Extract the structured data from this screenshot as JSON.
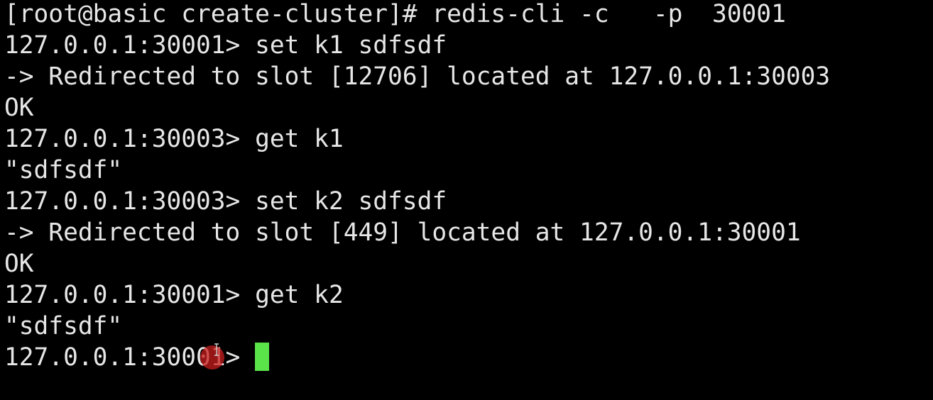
{
  "terminal": {
    "lines": [
      "[root@basic create-cluster]# redis-cli -c   -p  30001",
      "127.0.0.1:30001> set k1 sdfsdf",
      "-> Redirected to slot [12706] located at 127.0.0.1:30003",
      "OK",
      "127.0.0.1:30003> get k1",
      "\"sdfsdf\"",
      "127.0.0.1:30003> set k2 sdfsdf",
      "-> Redirected to slot [449] located at 127.0.0.1:30001",
      "OK",
      "127.0.0.1:30001> get k2",
      "\"sdfsdf\""
    ],
    "current_prompt": "127.0.0.1:30001> "
  },
  "colors": {
    "background": "#000000",
    "text": "#e6e6e6",
    "cursor": "#5be34a",
    "click_highlight": "#c81e1e"
  }
}
